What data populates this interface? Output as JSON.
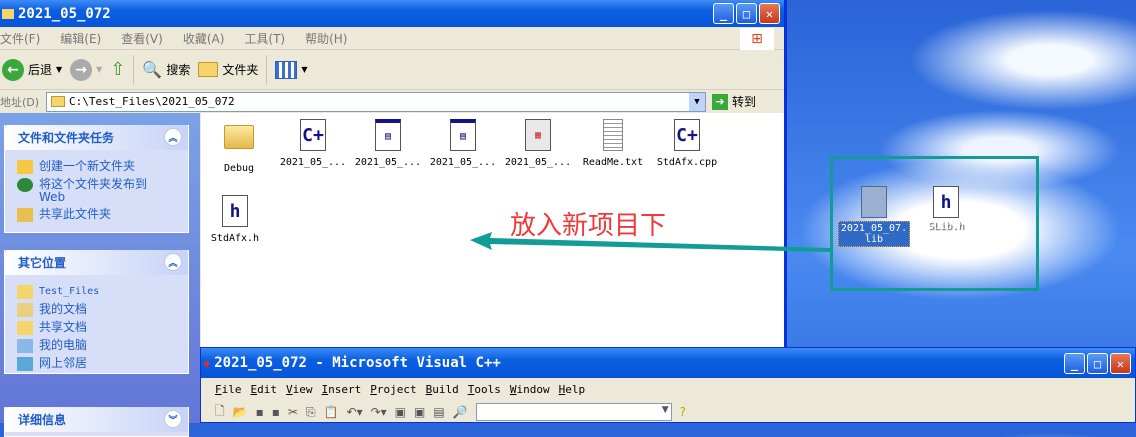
{
  "explorer": {
    "title": "2021_05_072",
    "menu": [
      "文件(F)",
      "编辑(E)",
      "查看(V)",
      "收藏(A)",
      "工具(T)",
      "帮助(H)"
    ],
    "toolbar": {
      "back": "后退",
      "search": "搜索",
      "folders": "文件夹"
    },
    "address": {
      "label": "地址(D)",
      "value": "C:\\Test_Files\\2021_05_072",
      "go": "转到"
    },
    "panels": [
      {
        "title": "文件和文件夹任务",
        "items": [
          "创建一个新文件夹",
          "将这个文件夹发布到 Web",
          "共享此文件夹"
        ]
      },
      {
        "title": "其它位置",
        "items": [
          "Test_Files",
          "我的文档",
          "共享文档",
          "我的电脑",
          "网上邻居"
        ]
      },
      {
        "title": "详细信息",
        "items": []
      }
    ],
    "files": [
      {
        "name": "Debug",
        "icon": "folder-icon"
      },
      {
        "name": "2021_05_...",
        "icon": "cpp-file-icon"
      },
      {
        "name": "2021_05_...",
        "icon": "workspace-file-icon"
      },
      {
        "name": "2021_05_...",
        "icon": "workspace-file-icon"
      },
      {
        "name": "2021_05_...",
        "icon": "resource-file-icon"
      },
      {
        "name": "ReadMe.txt",
        "icon": "text-file-icon"
      },
      {
        "name": "StdAfx.cpp",
        "icon": "cpp-file-icon"
      },
      {
        "name": "StdAfx.h",
        "icon": "header-file-icon"
      }
    ]
  },
  "annotation": {
    "text": "放入新项目下",
    "color": "#f03a3a",
    "arrow_color": "#139c96"
  },
  "desktop": {
    "files": [
      {
        "name": "2021_05_07.lib",
        "selected": true
      },
      {
        "name": "SLib.h",
        "selected": false
      }
    ]
  },
  "vc": {
    "title": "2021_05_072 - Microsoft Visual C++",
    "menu": [
      "File",
      "Edit",
      "View",
      "Insert",
      "Project",
      "Build",
      "Tools",
      "Window",
      "Help"
    ]
  }
}
